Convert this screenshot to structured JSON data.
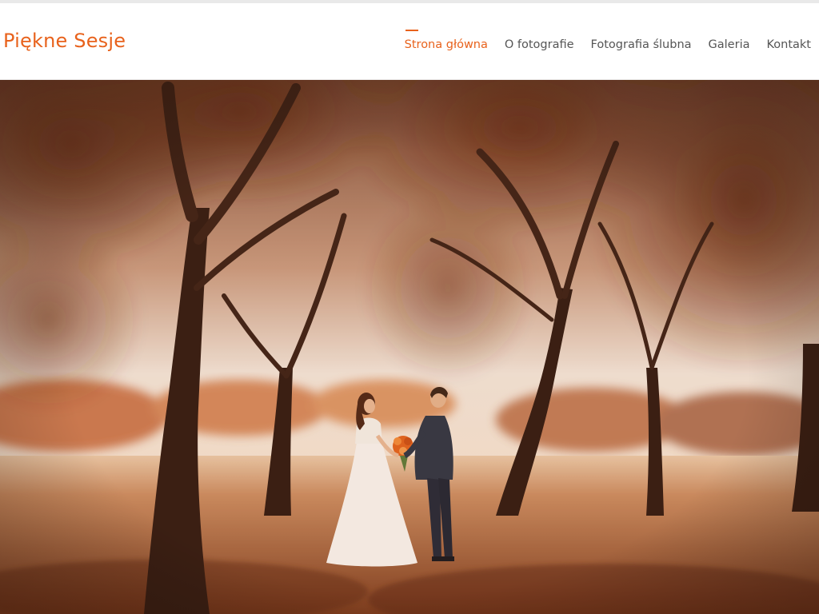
{
  "site": {
    "logo": "Piękne Sesje"
  },
  "nav": {
    "items": [
      {
        "label": "Strona główna",
        "active": true
      },
      {
        "label": "O fotografie",
        "active": false
      },
      {
        "label": "Fotografia ślubna",
        "active": false
      },
      {
        "label": "Galeria",
        "active": false
      },
      {
        "label": "Kontakt",
        "active": false
      }
    ]
  },
  "colors": {
    "accent": "#e8621c",
    "nav_text": "#555555",
    "header_bg": "#ffffff"
  },
  "hero": {
    "alt": "wedding couple among autumn trees"
  }
}
